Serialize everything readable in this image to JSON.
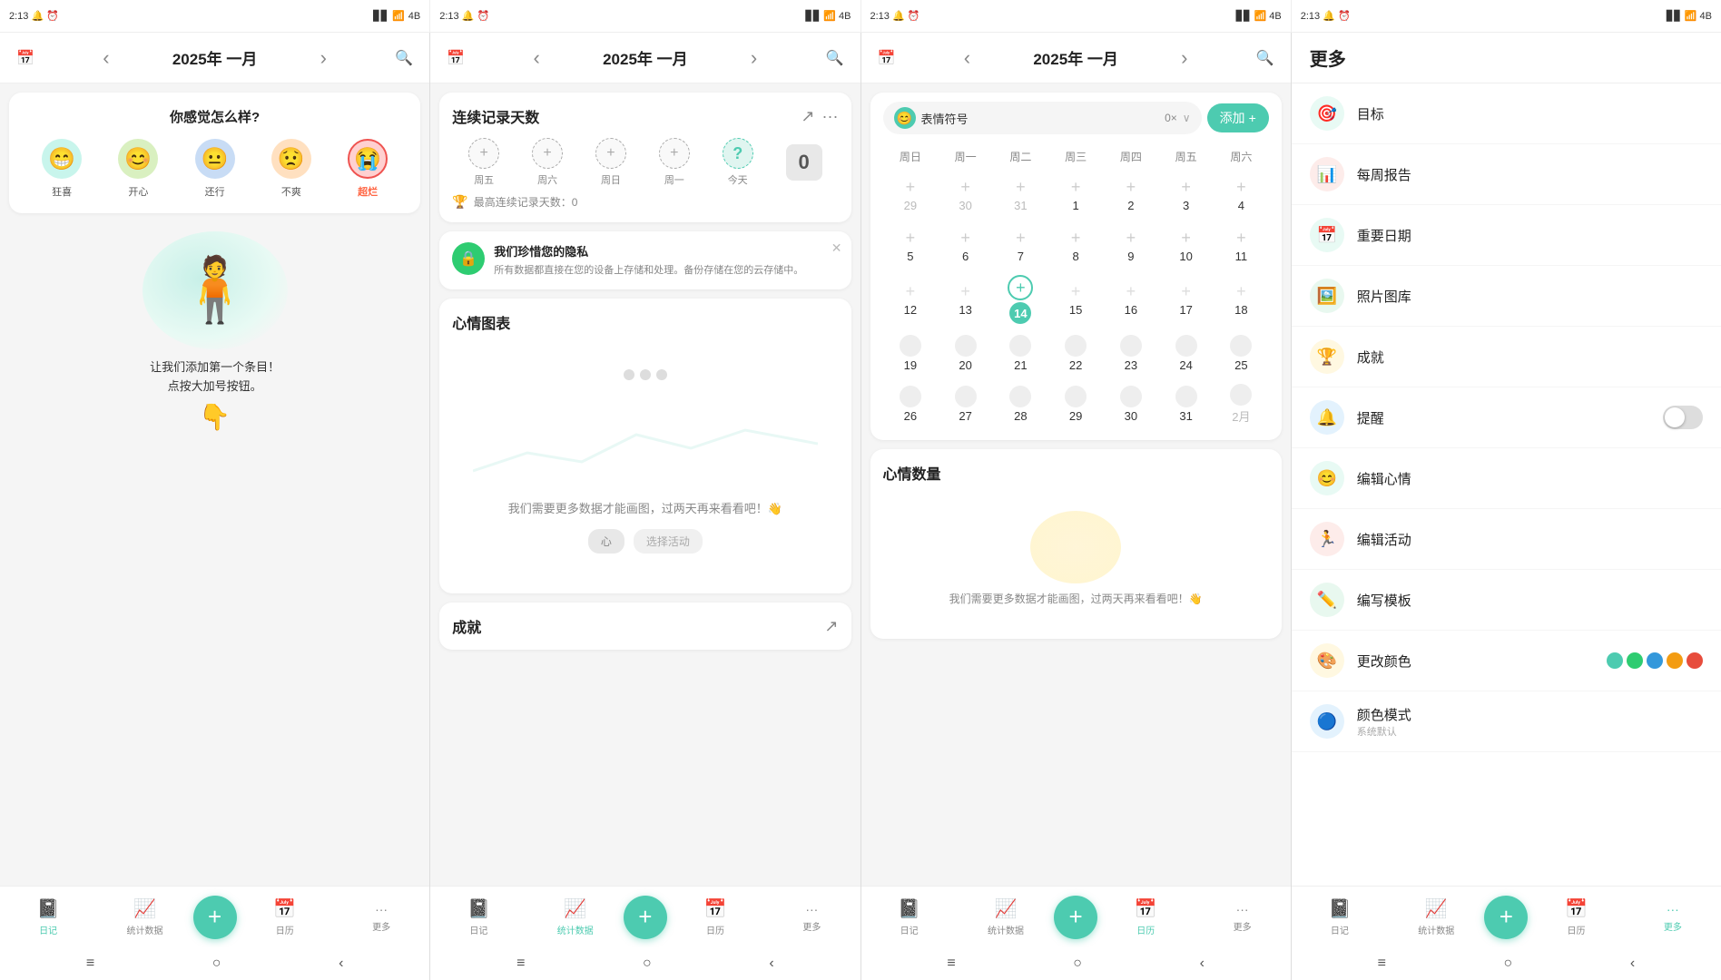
{
  "statusBar": {
    "time": "2:13",
    "battery": "4B",
    "signal": "↑↓"
  },
  "panels": [
    {
      "id": "panel1",
      "header": {
        "title": "2025年 一月",
        "leftIcon": "calendar",
        "navLeft": "‹",
        "navRight": "›",
        "searchIcon": "search"
      },
      "moodCard": {
        "title": "你感觉怎么样?",
        "moods": [
          {
            "emoji": "😁",
            "label": "狂喜",
            "color": "#4dcbb0",
            "active": false
          },
          {
            "emoji": "😊",
            "label": "开心",
            "color": "#a8d860",
            "active": false
          },
          {
            "emoji": "😐",
            "label": "还行",
            "color": "#64b5f6",
            "active": false
          },
          {
            "emoji": "😟",
            "label": "不爽",
            "color": "#ffb74d",
            "active": false
          },
          {
            "emoji": "😭",
            "label": "超烂",
            "color": "#ef5350",
            "active": true
          }
        ]
      },
      "illustration": {
        "text": "让我们添加第一个条目！\n点按大加号按钮。",
        "hand": "👇"
      }
    },
    {
      "id": "panel2",
      "header": {
        "title": "2025年 一月"
      },
      "streakCard": {
        "title": "连续记录天数",
        "days": [
          {
            "label": "周五",
            "type": "plus"
          },
          {
            "label": "周六",
            "type": "plus"
          },
          {
            "label": "周日",
            "type": "plus"
          },
          {
            "label": "周一",
            "type": "plus"
          },
          {
            "label": "今天",
            "type": "question"
          },
          {
            "label": "",
            "type": "count",
            "count": "0"
          }
        ],
        "record": "最高连续记录天数：0"
      },
      "privacyCard": {
        "title": "我们珍惜您的隐私",
        "desc": "所有数据都直接在您的设备上存储和处理。备份存储在您的云存储中。"
      },
      "chartCard": {
        "title": "心情图表",
        "message": "我们需要更多数据才能画图，过两天再来看看吧！👋"
      },
      "achievementCard": {
        "title": "成就"
      }
    },
    {
      "id": "panel3",
      "header": {
        "title": "2025年 一月"
      },
      "emojiSelector": {
        "name": "表情符号",
        "count": "0×",
        "addLabel": "添加"
      },
      "calendar": {
        "weekDays": [
          "周日",
          "周一",
          "周二",
          "周三",
          "周四",
          "周五",
          "周六"
        ],
        "weeks": [
          [
            {
              "num": "29",
              "type": "other"
            },
            {
              "num": "30",
              "type": "other"
            },
            {
              "num": "31",
              "type": "other"
            },
            {
              "num": "1",
              "type": "normal"
            },
            {
              "num": "2",
              "type": "normal"
            },
            {
              "num": "3",
              "type": "normal"
            },
            {
              "num": "4",
              "type": "normal"
            }
          ],
          [
            {
              "num": "5",
              "type": "normal"
            },
            {
              "num": "6",
              "type": "normal"
            },
            {
              "num": "7",
              "type": "normal"
            },
            {
              "num": "8",
              "type": "normal"
            },
            {
              "num": "9",
              "type": "normal"
            },
            {
              "num": "10",
              "type": "normal"
            },
            {
              "num": "11",
              "type": "normal"
            }
          ],
          [
            {
              "num": "12",
              "type": "normal"
            },
            {
              "num": "13",
              "type": "normal"
            },
            {
              "num": "14",
              "type": "today"
            },
            {
              "num": "15",
              "type": "normal"
            },
            {
              "num": "16",
              "type": "normal"
            },
            {
              "num": "17",
              "type": "normal"
            },
            {
              "num": "18",
              "type": "normal"
            }
          ],
          [
            {
              "num": "19",
              "type": "normal"
            },
            {
              "num": "20",
              "type": "normal"
            },
            {
              "num": "21",
              "type": "normal"
            },
            {
              "num": "22",
              "type": "normal"
            },
            {
              "num": "23",
              "type": "normal"
            },
            {
              "num": "24",
              "type": "normal"
            },
            {
              "num": "25",
              "type": "normal"
            }
          ],
          [
            {
              "num": "26",
              "type": "normal"
            },
            {
              "num": "27",
              "type": "normal"
            },
            {
              "num": "28",
              "type": "normal"
            },
            {
              "num": "29",
              "type": "normal"
            },
            {
              "num": "30",
              "type": "normal"
            },
            {
              "num": "31",
              "type": "normal"
            },
            {
              "num": "2月",
              "type": "other"
            }
          ]
        ]
      },
      "moodCountCard": {
        "title": "心情数量",
        "message": "我们需要更多数据才能画图，过两天再来看看吧！👋"
      }
    },
    {
      "id": "panel4-more",
      "header": {
        "title": "更多"
      },
      "items": [
        {
          "icon": "🎯",
          "label": "目标",
          "iconBg": "#4dcbb0",
          "hasArrow": false
        },
        {
          "icon": "📊",
          "label": "每周报告",
          "iconBg": "#ef5350",
          "hasArrow": false
        },
        {
          "icon": "📅",
          "label": "重要日期",
          "iconBg": "#4dcbb0",
          "hasArrow": false
        },
        {
          "icon": "🖼️",
          "label": "照片图库",
          "iconBg": "#2ecc71",
          "hasArrow": false
        },
        {
          "icon": "🏆",
          "label": "成就",
          "iconBg": "#f39c12",
          "hasArrow": false
        },
        {
          "icon": "🔔",
          "label": "提醒",
          "iconBg": "#3498db",
          "hasToggle": true,
          "toggleOn": false
        },
        {
          "icon": "😊",
          "label": "编辑心情",
          "iconBg": "#4dcbb0",
          "hasArrow": false
        },
        {
          "icon": "🏃",
          "label": "编辑活动",
          "iconBg": "#e74c3c",
          "hasArrow": false
        },
        {
          "icon": "✏️",
          "label": "编写模板",
          "iconBg": "#27ae60",
          "hasArrow": false
        },
        {
          "icon": "🎨",
          "label": "更改颜色",
          "iconBg": "#f39c12",
          "hasColors": true,
          "colors": [
            "#4dcbb0",
            "#2ecc71",
            "#3498db",
            "#f39c12",
            "#e74c3c"
          ]
        },
        {
          "icon": "🔵",
          "label": "颜色模式",
          "iconBg": "#3498db",
          "subLabel": "系统默认",
          "hasArrow": false
        }
      ]
    }
  ],
  "bottomNav": {
    "tabs": [
      {
        "label": "日记",
        "icon": "📓",
        "active": true
      },
      {
        "label": "统计数据",
        "icon": "📈",
        "active": false
      },
      {
        "label": "",
        "isFab": true
      },
      {
        "label": "日历",
        "icon": "📅",
        "active": false
      },
      {
        "label": "更多",
        "icon": "···",
        "active": false
      }
    ]
  },
  "androidNav": {
    "items": [
      "≡",
      "○",
      "‹"
    ]
  }
}
